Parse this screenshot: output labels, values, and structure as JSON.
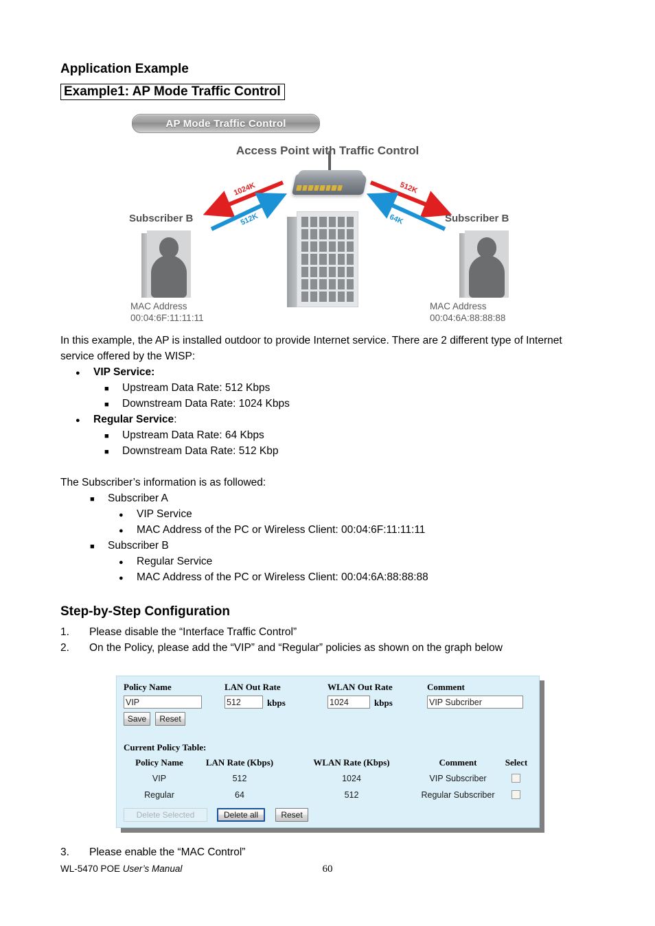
{
  "headings": {
    "application_example": "Application Example",
    "example_box": "Example1: AP Mode Traffic Control",
    "step_by_step": "Step-by-Step Configuration"
  },
  "diagram": {
    "badge": "AP Mode Traffic Control",
    "title": "Access Point with Traffic Control",
    "left_subscriber_label": "Subscriber B",
    "right_subscriber_label": "Subscriber B",
    "left_mac": "MAC Address\n00:04:6F:11:11:11",
    "right_mac": "MAC Address\n00:04:6A:88:88:88",
    "arrows": {
      "left_red": "1024K",
      "left_blue": "512K",
      "right_red": "512K",
      "right_blue": "64K"
    },
    "colors": {
      "red": "#e02020",
      "blue": "#1b92d6"
    }
  },
  "intro": {
    "line1": "In this example, the AP is installed outdoor to provide Internet service.    There are 2 different type of Internet",
    "line2": "service offered by the WISP:"
  },
  "services": [
    {
      "name": "VIP Service:",
      "items": [
        "Upstream Data Rate: 512 Kbps",
        "Downstream Data Rate: 1024 Kbps"
      ]
    },
    {
      "name": "Regular Service",
      "name_suffix": ":",
      "items": [
        "Upstream Data Rate: 64 Kbps",
        "Downstream Data Rate: 512 Kbp"
      ]
    }
  ],
  "subscriber_info": {
    "intro": "The Subscriber’s information is as followed:",
    "subscribers": [
      {
        "name": "Subscriber A",
        "details": [
          "VIP Service",
          "MAC Address of the PC or Wireless Client: 00:04:6F:11:11:11"
        ]
      },
      {
        "name": "Subscriber B",
        "details": [
          "Regular Service",
          "MAC Address of the PC or Wireless Client: 00:04:6A:88:88:88"
        ]
      }
    ]
  },
  "steps": [
    {
      "num": "1.",
      "text": "Please disable the “Interface Traffic Control”"
    },
    {
      "num": "2.",
      "text": "On the Policy, please add the “VIP” and “Regular” policies as shown on the graph below"
    },
    {
      "num": "3.",
      "text": "Please enable the “MAC Control”"
    }
  ],
  "config_panel": {
    "background_color": "#dcf0f9",
    "form": {
      "labels": {
        "policy_name": "Policy Name",
        "lan_out_rate": "LAN Out Rate",
        "wlan_out_rate": "WLAN Out Rate",
        "comment": "Comment"
      },
      "values": {
        "policy_name": "VIP",
        "lan_out_rate": "512",
        "wlan_out_rate": "1024",
        "comment": "VIP Subcriber"
      },
      "units": {
        "lan": "kbps",
        "wlan": "kbps"
      },
      "buttons": {
        "save": "Save",
        "reset": "Reset"
      }
    },
    "table": {
      "title": "Current Policy Table:",
      "headers": [
        "Policy Name",
        "LAN Rate (Kbps)",
        "WLAN Rate (Kbps)",
        "Comment",
        "Select"
      ],
      "rows": [
        {
          "policy_name": "VIP",
          "lan_rate": "512",
          "wlan_rate": "1024",
          "comment": "VIP Subscriber",
          "selected": false
        },
        {
          "policy_name": "Regular",
          "lan_rate": "64",
          "wlan_rate": "512",
          "comment": "Regular Subscriber",
          "selected": false
        }
      ]
    },
    "actions": {
      "delete_selected": "Delete Selected",
      "delete_all": "Delete all",
      "reset": "Reset"
    }
  },
  "footer": {
    "left_plain": "WL-5470 POE ",
    "left_italic": "User’s Manual",
    "page_number": "60"
  }
}
